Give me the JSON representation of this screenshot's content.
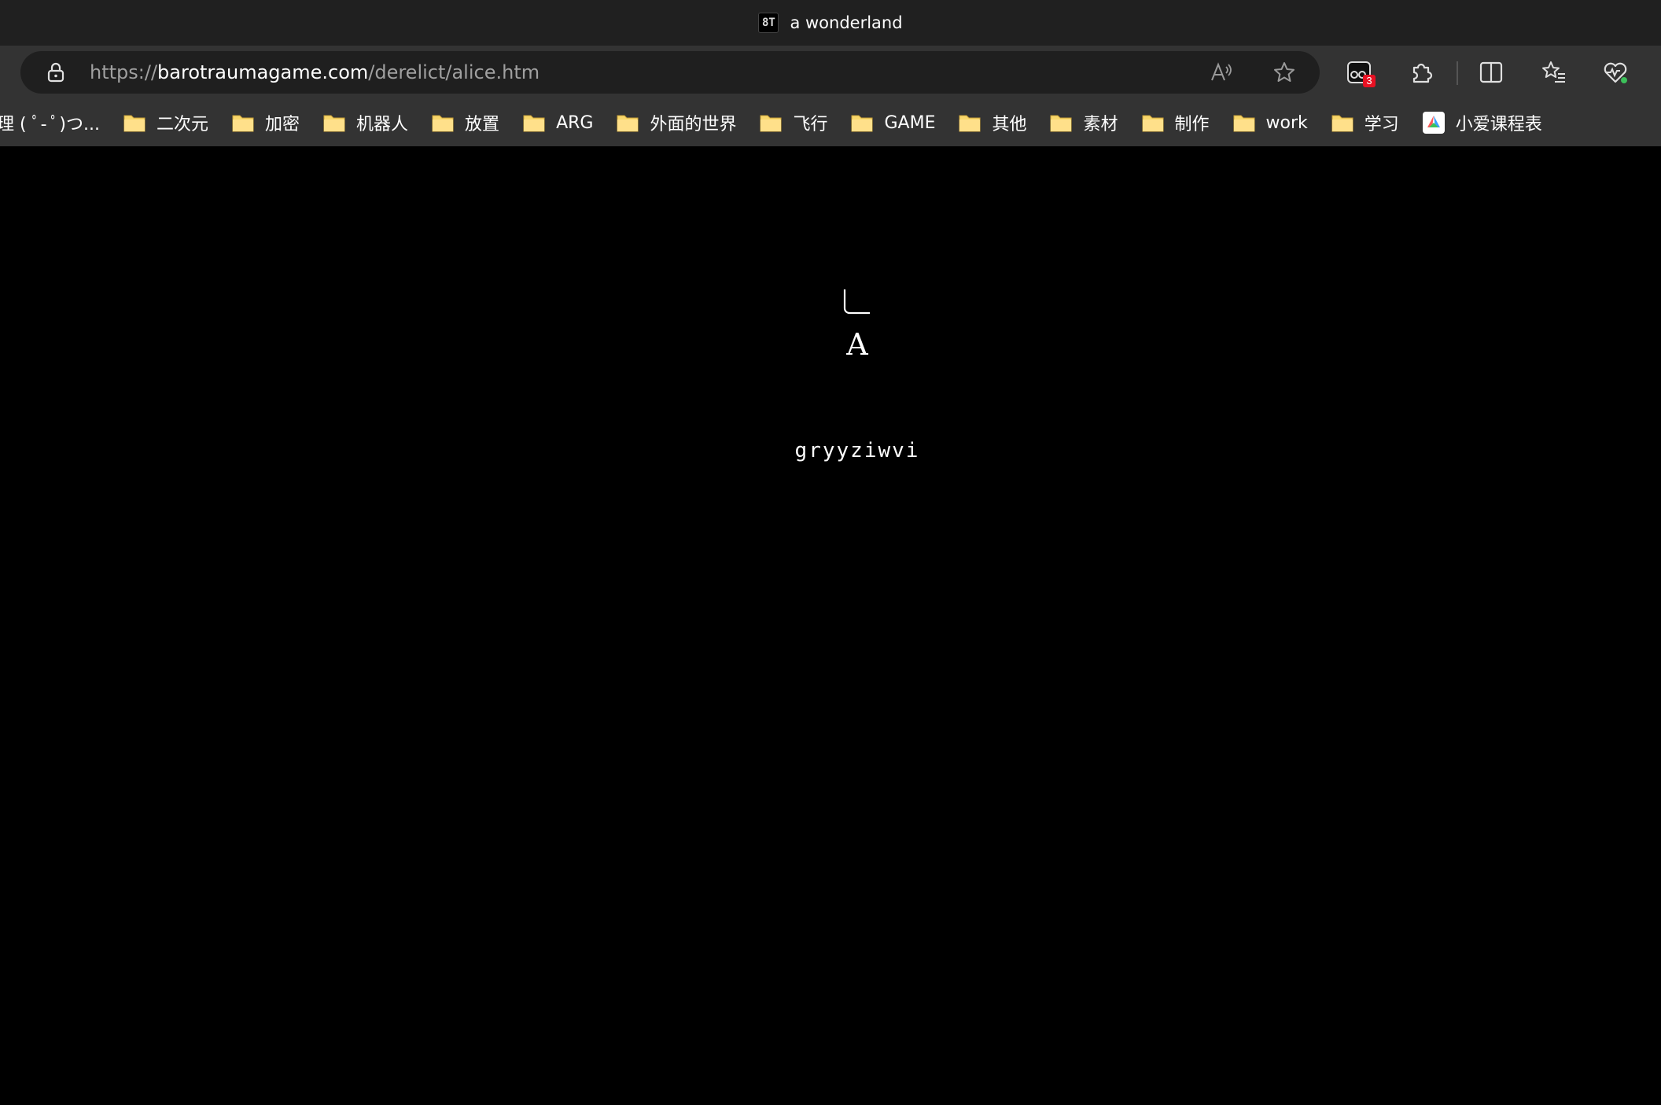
{
  "window": {
    "tab_title": "a wonderland",
    "favicon_text": "8T"
  },
  "address_bar": {
    "scheme": "https://",
    "host": "barotraumagame.com",
    "path": "/derelict/alice.htm"
  },
  "toolbar": {
    "extension_badge": "3",
    "icons": [
      "lock-icon",
      "read-aloud-icon",
      "add-favorite-icon",
      "extension-icon",
      "extensions-puzzle-icon",
      "split-screen-icon",
      "favorites-icon",
      "browser-health-icon"
    ]
  },
  "bookmarks": [
    {
      "label": "理 ( ﾟ- ﾟ)つ...",
      "type": "text"
    },
    {
      "label": "二次元",
      "type": "folder"
    },
    {
      "label": "加密",
      "type": "folder"
    },
    {
      "label": "机器人",
      "type": "folder"
    },
    {
      "label": "放置",
      "type": "folder"
    },
    {
      "label": "ARG",
      "type": "folder"
    },
    {
      "label": "外面的世界",
      "type": "folder"
    },
    {
      "label": "飞行",
      "type": "folder"
    },
    {
      "label": "GAME",
      "type": "folder"
    },
    {
      "label": "其他",
      "type": "folder"
    },
    {
      "label": "素材",
      "type": "folder"
    },
    {
      "label": "制作",
      "type": "folder"
    },
    {
      "label": "work",
      "type": "folder"
    },
    {
      "label": "学习",
      "type": "folder"
    },
    {
      "label": "小爱课程表",
      "type": "app"
    }
  ],
  "page": {
    "letter": "A",
    "cipher": "gryyziwvi",
    "background": "#000000",
    "text_color": "#ffffff"
  },
  "colors": {
    "titlebar": "#202020",
    "toolbar": "#333333",
    "addressbar": "#1f1f1f",
    "folder": "#f8d76b",
    "badge": "#e81123"
  }
}
